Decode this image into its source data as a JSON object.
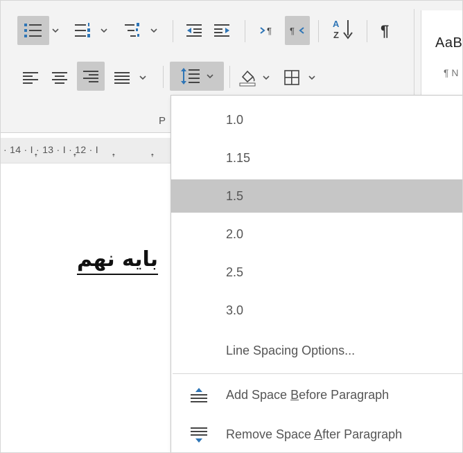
{
  "ribbon": {
    "group_label_partial": "P",
    "styles_sample": "AaB",
    "styles_name": "¶ N"
  },
  "ruler": {
    "numbers": "· 14 ·  I  · 13 ·  I  · 12 ·  I"
  },
  "document": {
    "visible_text": "بایه نهم"
  },
  "line_spacing_menu": {
    "items": [
      {
        "label": "1.0",
        "selected": false
      },
      {
        "label": "1.15",
        "selected": false
      },
      {
        "label": "1.5",
        "selected": true
      },
      {
        "label": "2.0",
        "selected": false
      },
      {
        "label": "2.5",
        "selected": false
      },
      {
        "label": "3.0",
        "selected": false
      }
    ],
    "options_label": "Line Spacing Options...",
    "add_before": {
      "pre": "Add Space ",
      "key": "B",
      "post": "efore Paragraph"
    },
    "remove_after": {
      "pre": "Remove Space ",
      "key": "A",
      "post": "fter Paragraph"
    }
  },
  "colors": {
    "accent_blue": "#2e75b6",
    "selected_bg": "#c6c6c6",
    "ribbon_bg": "#f3f3f3"
  }
}
